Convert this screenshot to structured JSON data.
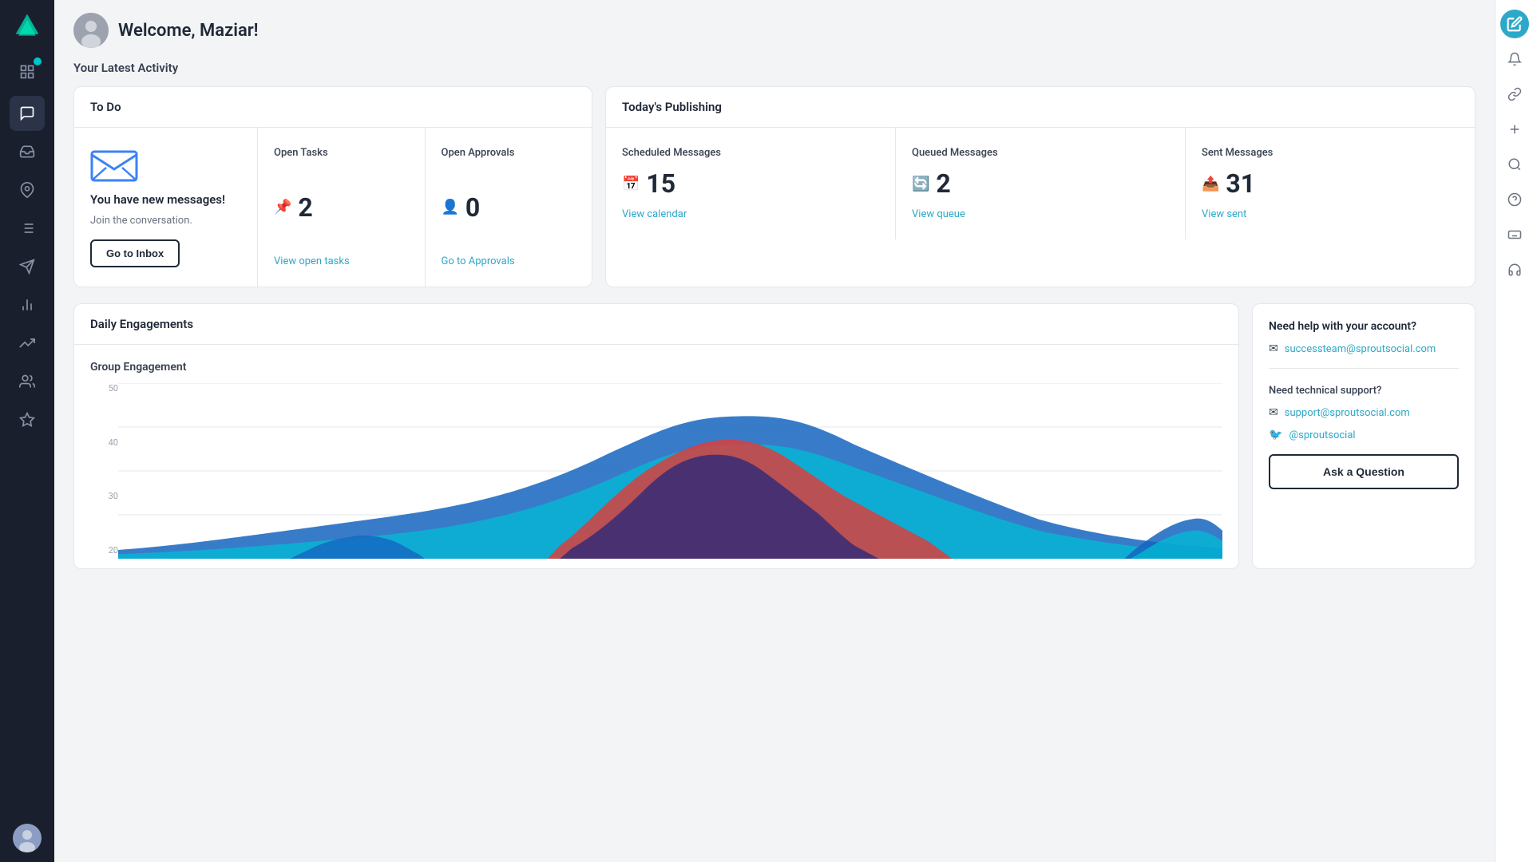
{
  "app": {
    "name": "Sprout Social"
  },
  "header": {
    "welcome_text": "Welcome, Maziar!"
  },
  "activity_section": {
    "title": "Your Latest Activity"
  },
  "todo_card": {
    "title": "To Do",
    "message_cell": {
      "title": "You have new messages!",
      "subtitle": "Join the conversation.",
      "button_label": "Go to Inbox"
    },
    "open_tasks": {
      "label": "Open Tasks",
      "value": "2",
      "link": "View open tasks"
    },
    "open_approvals": {
      "label": "Open Approvals",
      "value": "0",
      "link": "Go to Approvals"
    }
  },
  "publishing_card": {
    "title": "Today's Publishing",
    "scheduled": {
      "label": "Scheduled Messages",
      "value": "15",
      "link": "View calendar"
    },
    "queued": {
      "label": "Queued Messages",
      "value": "2",
      "link": "View queue"
    },
    "sent": {
      "label": "Sent Messages",
      "value": "31",
      "link": "View sent"
    }
  },
  "engagements_card": {
    "title": "Daily Engagements",
    "chart_title": "Group Engagement",
    "y_labels": [
      "50",
      "40",
      "30",
      "20"
    ],
    "colors": {
      "blue": "#1e6fb5",
      "cyan": "#00bcd4",
      "red": "#e53935",
      "pink": "#e91e63"
    }
  },
  "help_card": {
    "help_account_title": "Need help with your account?",
    "help_account_email": "successteam@sproutsocial.com",
    "help_technical_title": "Need technical support?",
    "help_technical_email": "support@sproutsocial.com",
    "help_twitter": "@sproutsocial",
    "ask_button_label": "Ask a Question"
  },
  "sidebar": {
    "items": [
      {
        "name": "home",
        "icon": "🏠"
      },
      {
        "name": "inbox",
        "icon": "📥"
      },
      {
        "name": "pin",
        "icon": "📌"
      },
      {
        "name": "tasks",
        "icon": "☰"
      },
      {
        "name": "send",
        "icon": "✉"
      },
      {
        "name": "analytics",
        "icon": "📊"
      },
      {
        "name": "reports",
        "icon": "📈"
      },
      {
        "name": "tools",
        "icon": "🔧"
      },
      {
        "name": "star",
        "icon": "⭐"
      }
    ]
  },
  "right_sidebar": {
    "compose_icon": "✏",
    "icons": [
      "🔔",
      "🔗",
      "➕",
      "🔍",
      "❓",
      "⌨",
      "🎧"
    ]
  }
}
